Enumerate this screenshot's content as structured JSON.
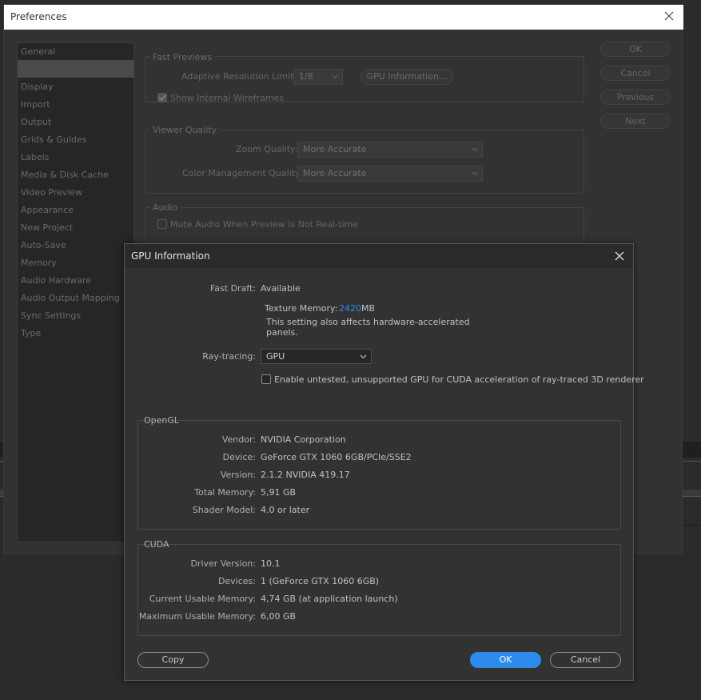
{
  "background": {},
  "preferences": {
    "title": "Preferences",
    "sidebar": [
      "General",
      "",
      "Display",
      "Import",
      "Output",
      "Grids & Guides",
      "Labels",
      "Media & Disk Cache",
      "Video Preview",
      "Appearance",
      "New Project",
      "Auto-Save",
      "Memory",
      "Audio Hardware",
      "Audio Output Mapping",
      "Sync Settings",
      "Type"
    ],
    "fast_previews": {
      "group_label": "Fast Previews",
      "adaptive_label": "Adaptive Resolution Limit:",
      "adaptive_value": "1/8",
      "gpu_info_button": "GPU Information...",
      "wireframes_label": "Show Internal Wireframes"
    },
    "viewer_quality": {
      "group_label": "Viewer Quality",
      "zoom_label": "Zoom Quality:",
      "zoom_value": "More Accurate",
      "color_label": "Color Management Quality:",
      "color_value": "More Accurate"
    },
    "audio": {
      "group_label": "Audio",
      "mute_label": "Mute Audio When Preview Is Not Real-time"
    },
    "buttons": {
      "ok": "OK",
      "cancel": "Cancel",
      "previous": "Previous",
      "next": "Next"
    }
  },
  "gpu_dialog": {
    "title": "GPU Information",
    "fast_draft_label": "Fast Draft:",
    "fast_draft_value": "Available",
    "texture_memory_label": "Texture Memory:",
    "texture_memory_value": "2420",
    "texture_memory_unit": "MB",
    "note_line1": "This setting also affects hardware-accelerated",
    "note_line2": "panels.",
    "raytracing_label": "Ray-tracing:",
    "raytracing_value": "GPU",
    "untested_label": "Enable untested, unsupported GPU for CUDA acceleration of ray-traced 3D renderer",
    "opengl": {
      "group_label": "OpenGL",
      "rows": [
        {
          "label": "Vendor:",
          "value": "NVIDIA Corporation"
        },
        {
          "label": "Device:",
          "value": "GeForce GTX 1060 6GB/PCIe/SSE2"
        },
        {
          "label": "Version:",
          "value": "2.1.2 NVIDIA 419.17"
        },
        {
          "label": "Total Memory:",
          "value": "5,91 GB"
        },
        {
          "label": "Shader Model:",
          "value": "4.0 or later"
        }
      ]
    },
    "cuda": {
      "group_label": "CUDA",
      "rows": [
        {
          "label": "Driver Version:",
          "value": "10.1"
        },
        {
          "label": "Devices:",
          "value": "1 (GeForce GTX 1060 6GB)"
        },
        {
          "label": "Current Usable Memory:",
          "value": "4,74 GB (at application launch)"
        },
        {
          "label": "Maximum Usable Memory:",
          "value": "6,00 GB"
        }
      ]
    },
    "buttons": {
      "copy": "Copy",
      "ok": "OK",
      "cancel": "Cancel"
    },
    "accent_color": "#2d8ceb",
    "value_highlight_color": "#2d8ceb"
  }
}
